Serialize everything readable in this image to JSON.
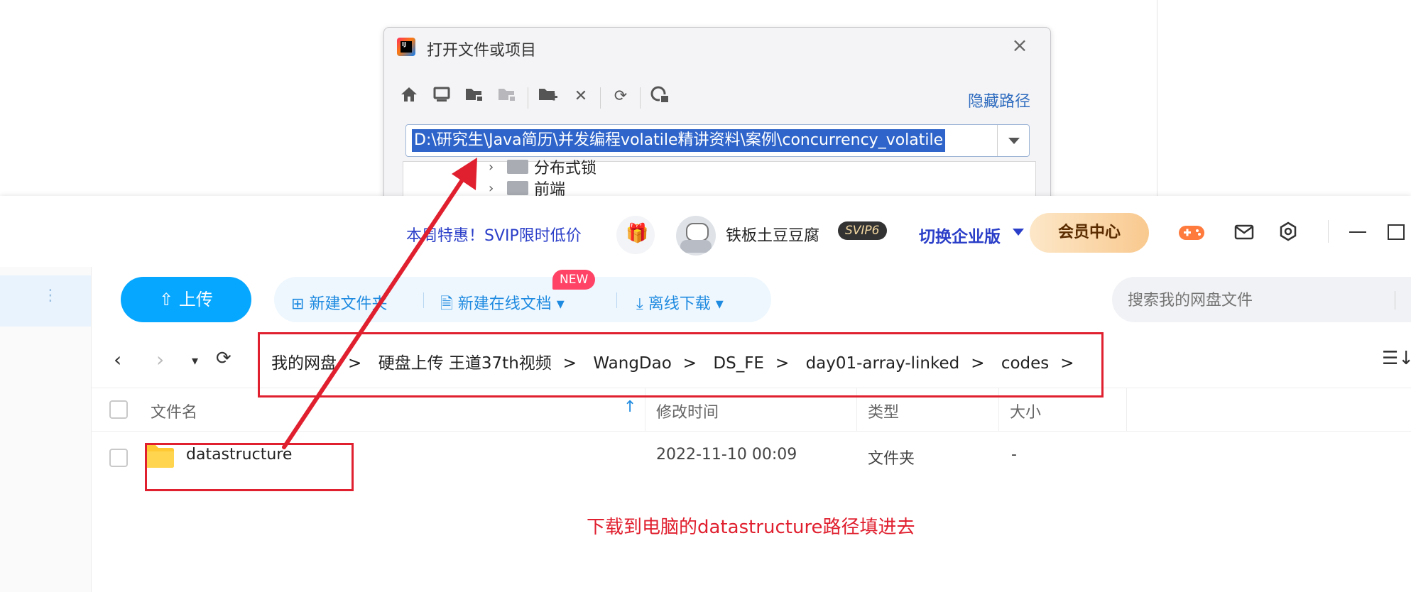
{
  "ij_dialog": {
    "title": "打开文件或项目",
    "logo_text": "IJ",
    "hide_path_label": "隐藏路径",
    "path_value": "D:\\研究生\\Java简历\\并发编程volatile精讲资料\\案例\\concurrency_volatile",
    "tree_items": [
      "分布式锁",
      "前端"
    ],
    "toolbar_icons": [
      "home-icon",
      "desktop-icon",
      "project-folder-icon",
      "module-folder-icon",
      "new-folder-icon",
      "delete-icon",
      "refresh-icon",
      "show-hidden-icon"
    ]
  },
  "topbar": {
    "promo": "本周特惠！SVIP限时低价",
    "gift_icon": "gift-icon",
    "username": "铁板土豆豆腐",
    "vip_badge": "SVIP6",
    "switch_enterprise": "切换企业版",
    "member_center": "会员中心",
    "icons": [
      "game-icon",
      "mail-icon",
      "gear-icon",
      "minimize-icon",
      "maximize-icon"
    ]
  },
  "actions": {
    "upload": "上传",
    "new_folder": "新建文件夹",
    "new_online_doc": "新建在线文档",
    "new_badge": "NEW",
    "offline_download": "离线下载",
    "search_placeholder": "搜索我的网盘文件"
  },
  "nav": {
    "breadcrumb": [
      "我的网盘",
      "硬盘上传 王道37th视频",
      "WangDao",
      "DS_FE",
      "day01-array-linked",
      "codes"
    ]
  },
  "table": {
    "columns": [
      "文件名",
      "修改时间",
      "类型",
      "大小"
    ],
    "rows": [
      {
        "name": "datastructure",
        "modified": "2022-11-10 00:09",
        "type": "文件夹",
        "size": "-"
      }
    ]
  },
  "annotation": {
    "note": "下载到电脑的datastructure路径填进去",
    "color": "#e0202f"
  },
  "colors": {
    "accent": "#06a7ff",
    "link_blue": "#2a3ec8",
    "selection": "#2f65ca"
  }
}
